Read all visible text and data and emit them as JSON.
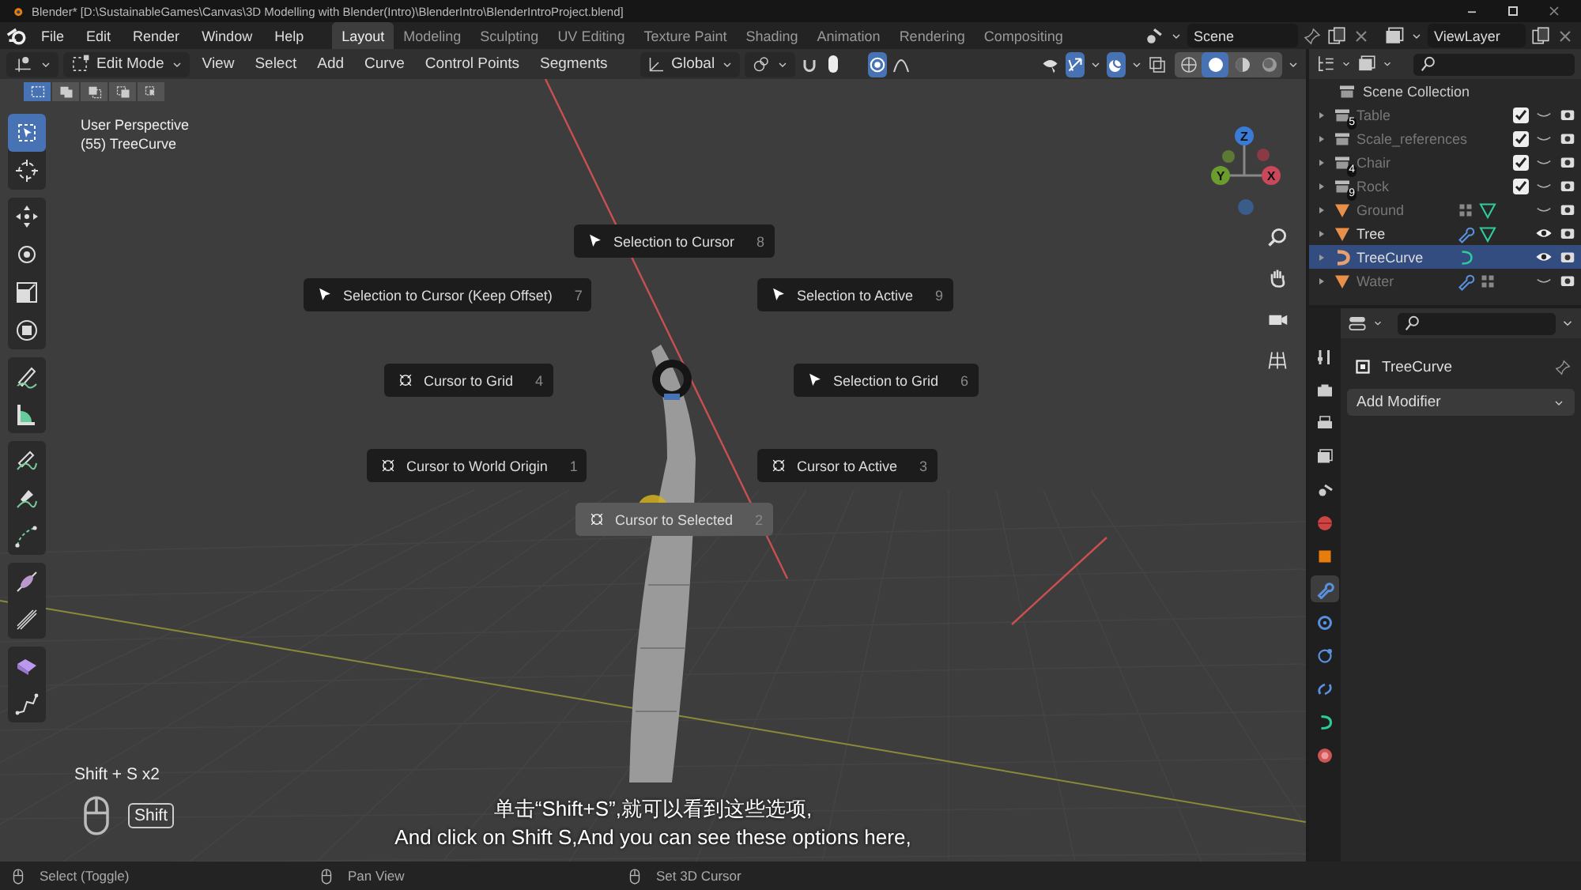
{
  "window": {
    "title": "Blender* [D:\\SustainableGames\\Canvas\\3D Modelling with Blender(Intro)\\BlenderIntro\\BlenderIntroProject.blend]"
  },
  "menu": [
    "File",
    "Edit",
    "Render",
    "Window",
    "Help"
  ],
  "workspace_tabs": [
    {
      "label": "Layout",
      "selected": true
    },
    {
      "label": "Modeling",
      "selected": false
    },
    {
      "label": "Sculpting",
      "selected": false
    },
    {
      "label": "UV Editing",
      "selected": false
    },
    {
      "label": "Texture Paint",
      "selected": false
    },
    {
      "label": "Shading",
      "selected": false
    },
    {
      "label": "Animation",
      "selected": false
    },
    {
      "label": "Rendering",
      "selected": false
    },
    {
      "label": "Compositing",
      "selected": false
    }
  ],
  "scene": {
    "label": "Scene"
  },
  "view_layer": {
    "label": "ViewLayer"
  },
  "header": {
    "mode": "Edit Mode",
    "menus": [
      "View",
      "Select",
      "Add",
      "Curve",
      "Control Points",
      "Segments"
    ],
    "orientation": "Global",
    "toggles": [
      {
        "kind": "snap",
        "on": false
      },
      {
        "kind": "proportional",
        "on": true
      },
      {
        "kind": "visibility",
        "on": false
      },
      {
        "kind": "gizmo",
        "on": true
      },
      {
        "kind": "overlay",
        "on": true
      },
      {
        "kind": "xray",
        "on": false
      }
    ],
    "shading": [
      {
        "kind": "wireframe",
        "selected": false
      },
      {
        "kind": "solid",
        "selected": true
      },
      {
        "kind": "material",
        "selected": false
      },
      {
        "kind": "rendered",
        "selected": false
      }
    ]
  },
  "select_modes": [
    {
      "kind": "set",
      "selected": true
    },
    {
      "kind": "extend",
      "selected": false
    },
    {
      "kind": "subtract",
      "selected": false
    },
    {
      "kind": "invert",
      "selected": false
    },
    {
      "kind": "intersect",
      "selected": false
    }
  ],
  "toolbar": [
    {
      "tools": [
        {
          "kind": "select",
          "selected": true
        },
        {
          "kind": "cursor",
          "selected": false
        }
      ]
    },
    {
      "tools": [
        {
          "kind": "move",
          "selected": false
        },
        {
          "kind": "rotate",
          "selected": false
        },
        {
          "kind": "scale",
          "selected": false
        },
        {
          "kind": "transform",
          "selected": false
        }
      ]
    },
    {
      "tools": [
        {
          "kind": "annotate",
          "selected": false
        },
        {
          "kind": "measure",
          "selected": false
        }
      ]
    },
    {
      "tools": [
        {
          "kind": "draw",
          "selected": false
        },
        {
          "kind": "pen",
          "selected": false
        },
        {
          "kind": "curve",
          "selected": false
        }
      ]
    },
    {
      "tools": [
        {
          "kind": "tilt",
          "selected": false
        },
        {
          "kind": "radius",
          "selected": false
        }
      ]
    },
    {
      "tools": [
        {
          "kind": "extrude",
          "selected": false
        },
        {
          "kind": "randomize",
          "selected": false
        }
      ]
    }
  ],
  "viewport_info": [
    "User Perspective",
    "(55) TreeCurve"
  ],
  "nav_gizmo": {
    "axes": [
      "Z",
      "Y",
      "X"
    ]
  },
  "pie_menu": {
    "items": [
      {
        "label": "Selection to Cursor",
        "shortcut": "8",
        "kind": "arrow",
        "selected": false
      },
      {
        "label": "Selection to Cursor (Keep Offset)",
        "shortcut": "7",
        "kind": "arrow",
        "selected": false
      },
      {
        "label": "Selection to Active",
        "shortcut": "9",
        "kind": "arrow",
        "selected": false
      },
      {
        "label": "Cursor to Grid",
        "shortcut": "4",
        "kind": "cursor",
        "selected": false
      },
      {
        "label": "Selection to Grid",
        "shortcut": "6",
        "kind": "arrow",
        "selected": false
      },
      {
        "label": "Cursor to World Origin",
        "shortcut": "1",
        "kind": "cursor",
        "selected": false
      },
      {
        "label": "Cursor to Active",
        "shortcut": "3",
        "kind": "cursor",
        "selected": false
      },
      {
        "label": "Cursor to Selected",
        "shortcut": "2",
        "kind": "cursor",
        "selected": true
      }
    ]
  },
  "keystrokes": {
    "combo": "Shift + S x2",
    "key": "Shift"
  },
  "subtitles": [
    "单击“Shift+S”,就可以看到这些选项,",
    "And click on Shift S,And you can see these options here,"
  ],
  "outliner": {
    "root": "Scene Collection",
    "rows": [
      {
        "name": "Table",
        "kind": "collection",
        "badge": "5",
        "checked": true,
        "visible": false,
        "selected": false,
        "extras": []
      },
      {
        "name": "Scale_references",
        "kind": "collection",
        "checked": true,
        "visible": false,
        "selected": false,
        "extras": []
      },
      {
        "name": "Chair",
        "kind": "collection",
        "badge": "4",
        "checked": true,
        "visible": false,
        "selected": false,
        "extras": []
      },
      {
        "name": "Rock",
        "kind": "collection",
        "badge": "9",
        "checked": true,
        "visible": false,
        "selected": false,
        "extras": []
      },
      {
        "name": "Ground",
        "kind": "mesh",
        "visible": false,
        "selected": false,
        "extras": [
          {
            "kind": "grid"
          },
          {
            "kind": "mesh"
          }
        ]
      },
      {
        "name": "Tree",
        "kind": "mesh",
        "visible": true,
        "selected": false,
        "extras": [
          {
            "kind": "wrench"
          },
          {
            "kind": "mesh"
          }
        ]
      },
      {
        "name": "TreeCurve",
        "kind": "curve",
        "visible": true,
        "selected": true,
        "extras": [
          {
            "kind": "curve"
          }
        ]
      },
      {
        "name": "Water",
        "kind": "mesh",
        "visible": false,
        "selected": false,
        "extras": [
          {
            "kind": "wrench"
          },
          {
            "kind": "grid"
          }
        ]
      }
    ]
  },
  "properties": {
    "object_name": "TreeCurve",
    "add_modifier": "Add Modifier",
    "tabs": [
      {
        "kind": "tool",
        "selected": false
      },
      {
        "kind": "render",
        "selected": false
      },
      {
        "kind": "output",
        "selected": false
      },
      {
        "kind": "view_layer",
        "selected": false
      },
      {
        "kind": "scene",
        "selected": false
      },
      {
        "kind": "world",
        "selected": false
      },
      {
        "kind": "object",
        "selected": false
      },
      {
        "kind": "modifier",
        "selected": true
      },
      {
        "kind": "particles",
        "selected": false
      },
      {
        "kind": "physics",
        "selected": false
      },
      {
        "kind": "constraints",
        "selected": false
      },
      {
        "kind": "data",
        "selected": false
      },
      {
        "kind": "material",
        "selected": false
      }
    ]
  },
  "status_bar": [
    {
      "label": "Select (Toggle)"
    },
    {
      "label": "Pan View"
    },
    {
      "label": "Set 3D Cursor"
    }
  ]
}
